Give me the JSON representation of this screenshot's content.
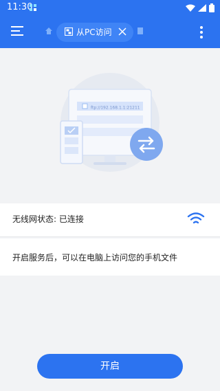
{
  "statusbar": {
    "time": "11:30"
  },
  "appbar": {
    "tab_label": "从PC访问"
  },
  "illustration": {
    "ftp_address": "ftp://192.168.1.1:21211"
  },
  "wifi": {
    "status_label": "无线网状态: 已连接"
  },
  "info": {
    "description": "开启服务后，可以在电脑上访问您的手机文件"
  },
  "actions": {
    "start_label": "开启"
  },
  "colors": {
    "primary": "#2c73f0",
    "background": "#f2f3f5"
  }
}
